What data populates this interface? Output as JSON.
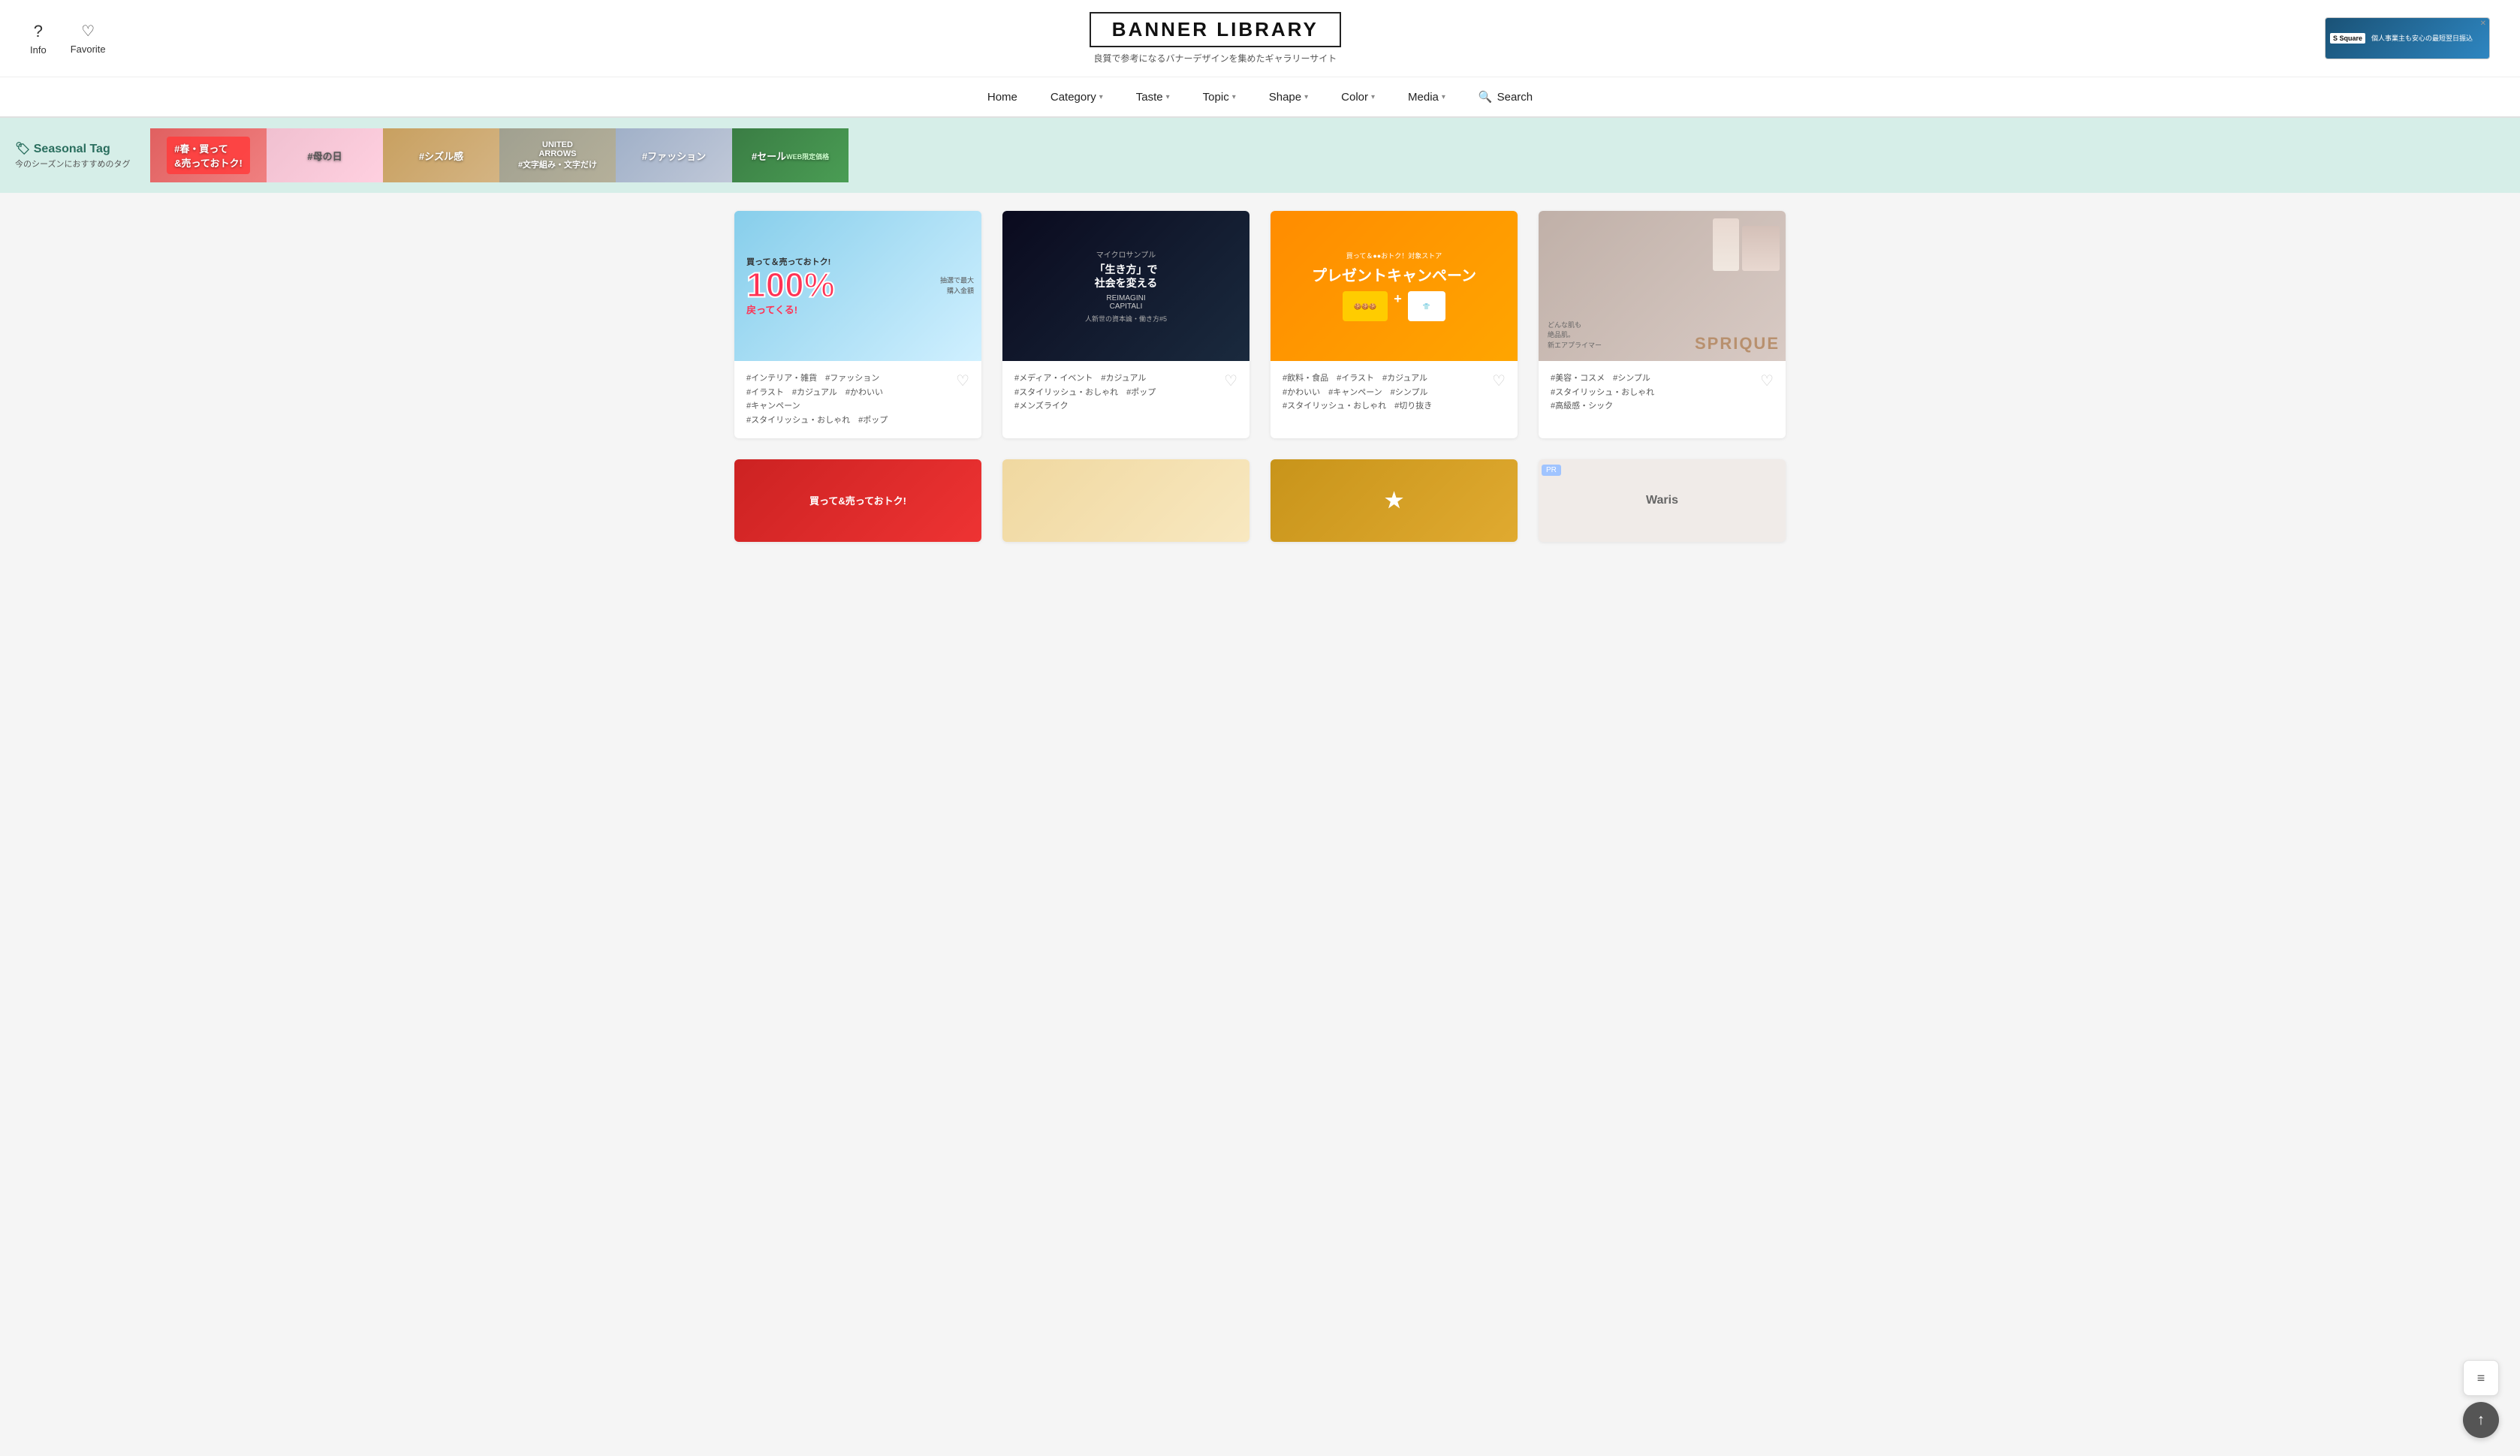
{
  "header": {
    "info_label": "Info",
    "favorite_label": "Favorite",
    "logo": "BANNER LIBRARY",
    "subtitle": "良質で参考になるバナーデザインを集めたギャラリーサイト",
    "ad_text": "個人事業主も安心の最短翌日振込"
  },
  "navbar": {
    "items": [
      {
        "label": "Home",
        "has_dropdown": false
      },
      {
        "label": "Category",
        "has_dropdown": true
      },
      {
        "label": "Taste",
        "has_dropdown": true
      },
      {
        "label": "Topic",
        "has_dropdown": true
      },
      {
        "label": "Shape",
        "has_dropdown": true
      },
      {
        "label": "Color",
        "has_dropdown": true
      },
      {
        "label": "Media",
        "has_dropdown": true
      }
    ],
    "search_label": "Search"
  },
  "seasonal": {
    "title": "🏷 Seasonal Tag",
    "subtitle": "今のシーズンにおすすめのタグ",
    "tags": [
      {
        "label": "#春・買って＆売ってお",
        "bg": "#e8a0a0"
      },
      {
        "label": "#母の日",
        "bg": "#f0c0d0"
      },
      {
        "label": "#シズル感",
        "bg": "#d4b483"
      },
      {
        "label": "#文字組み・文字だけ",
        "bg": "#b5b09a"
      },
      {
        "label": "#ファッション",
        "bg": "#c0c8d8"
      },
      {
        "label": "#セール",
        "bg": "#3a7d44"
      }
    ]
  },
  "cards": [
    {
      "tags": "#インテリア・雑貨　#ファッション\n#イラスト　#カジュアル　#かわいい\n#キャンペーン\n#スタイリッシュ・おしゃれ　#ポップ",
      "bg_color": "#87ceeb",
      "banner_type": "1"
    },
    {
      "tags": "#メディア・イベント　#カジュアル\n#スタイリッシュ・おしゃれ　#ポップ\n#メンズライク",
      "bg_color": "#1a1a2e",
      "banner_type": "2"
    },
    {
      "tags": "#飲料・食品　#イラスト　#カジュアル\n#かわいい　#キャンペーン　#シンプル\n#スタイリッシュ・おしゃれ　#切り抜き",
      "bg_color": "#ff8c00",
      "banner_type": "3"
    },
    {
      "tags": "#美容・コスメ　#シンプル\n#スタイリッシュ・おしゃれ\n#高級感・シック",
      "bg_color": "#c8b0a8",
      "banner_type": "4"
    }
  ],
  "partial_cards": [
    {
      "bg_color": "#cc3333",
      "has_pr": false
    },
    {
      "bg_color": "#f0e0c0",
      "has_pr": false
    },
    {
      "bg_color": "#d4a020",
      "has_pr": false
    },
    {
      "bg_color": "#e0d0c8",
      "has_pr": true
    }
  ],
  "fab": {
    "menu_icon": "≡",
    "up_icon": "↑"
  }
}
